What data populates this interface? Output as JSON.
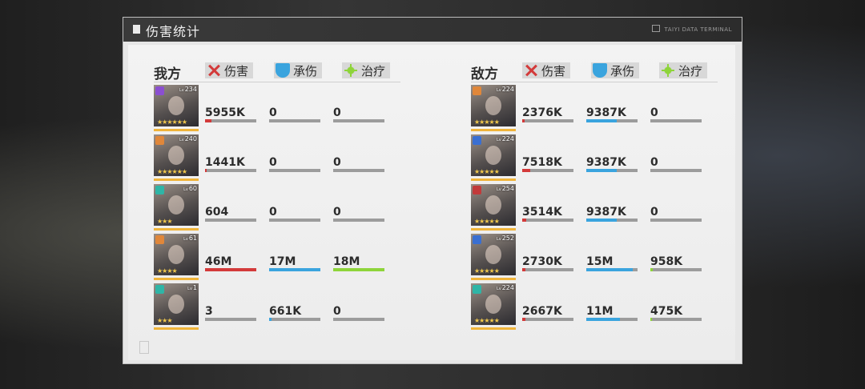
{
  "header": {
    "title": "伤害统计",
    "terminal": "TAIYI DATA TERMINAL"
  },
  "columns": {
    "damage": "伤害",
    "tank": "承伤",
    "heal": "治疗"
  },
  "colors": {
    "damage": "#d33a3a",
    "tank": "#3aa4de",
    "heal": "#8ed43a",
    "star": "#f2c94c"
  },
  "teams": [
    {
      "name": "我方",
      "rows": [
        {
          "level": "234",
          "cls_color": "#8b4fd1",
          "stars": "★★★★★★",
          "damage": "5955K",
          "tank": "0",
          "heal": "0",
          "dmg_f": 0.12,
          "tank_f": 0,
          "heal_f": 0
        },
        {
          "level": "240",
          "cls_color": "#e0873a",
          "stars": "★★★★★★",
          "damage": "1441K",
          "tank": "0",
          "heal": "0",
          "dmg_f": 0.03,
          "tank_f": 0,
          "heal_f": 0
        },
        {
          "level": "60",
          "cls_color": "#2fb5a6",
          "stars": "★★★",
          "damage": "604",
          "tank": "0",
          "heal": "0",
          "dmg_f": 0,
          "tank_f": 0,
          "heal_f": 0
        },
        {
          "level": "61",
          "cls_color": "#e0873a",
          "stars": "★★★★",
          "damage": "46M",
          "tank": "17M",
          "heal": "18M",
          "dmg_f": 1,
          "tank_f": 1,
          "heal_f": 1
        },
        {
          "level": "1",
          "cls_color": "#2fb5a6",
          "stars": "★★★",
          "damage": "3",
          "tank": "661K",
          "heal": "0",
          "dmg_f": 0,
          "tank_f": 0.04,
          "heal_f": 0
        }
      ]
    },
    {
      "name": "敌方",
      "rows": [
        {
          "level": "224",
          "cls_color": "#e0873a",
          "stars": "★★★★★",
          "damage": "2376K",
          "tank": "9387K",
          "heal": "0",
          "dmg_f": 0.05,
          "tank_f": 0.6,
          "heal_f": 0
        },
        {
          "level": "224",
          "cls_color": "#3a6fd1",
          "stars": "★★★★★",
          "damage": "7518K",
          "tank": "9387K",
          "heal": "0",
          "dmg_f": 0.16,
          "tank_f": 0.6,
          "heal_f": 0
        },
        {
          "level": "254",
          "cls_color": "#c23a3a",
          "stars": "★★★★★",
          "damage": "3514K",
          "tank": "9387K",
          "heal": "0",
          "dmg_f": 0.08,
          "tank_f": 0.6,
          "heal_f": 0
        },
        {
          "level": "252",
          "cls_color": "#3a6fd1",
          "stars": "★★★★★",
          "damage": "2730K",
          "tank": "15M",
          "heal": "958K",
          "dmg_f": 0.06,
          "tank_f": 0.9,
          "heal_f": 0.05
        },
        {
          "level": "224",
          "cls_color": "#2fb5a6",
          "stars": "★★★★★",
          "damage": "2667K",
          "tank": "11M",
          "heal": "475K",
          "dmg_f": 0.06,
          "tank_f": 0.65,
          "heal_f": 0.03
        }
      ]
    }
  ]
}
